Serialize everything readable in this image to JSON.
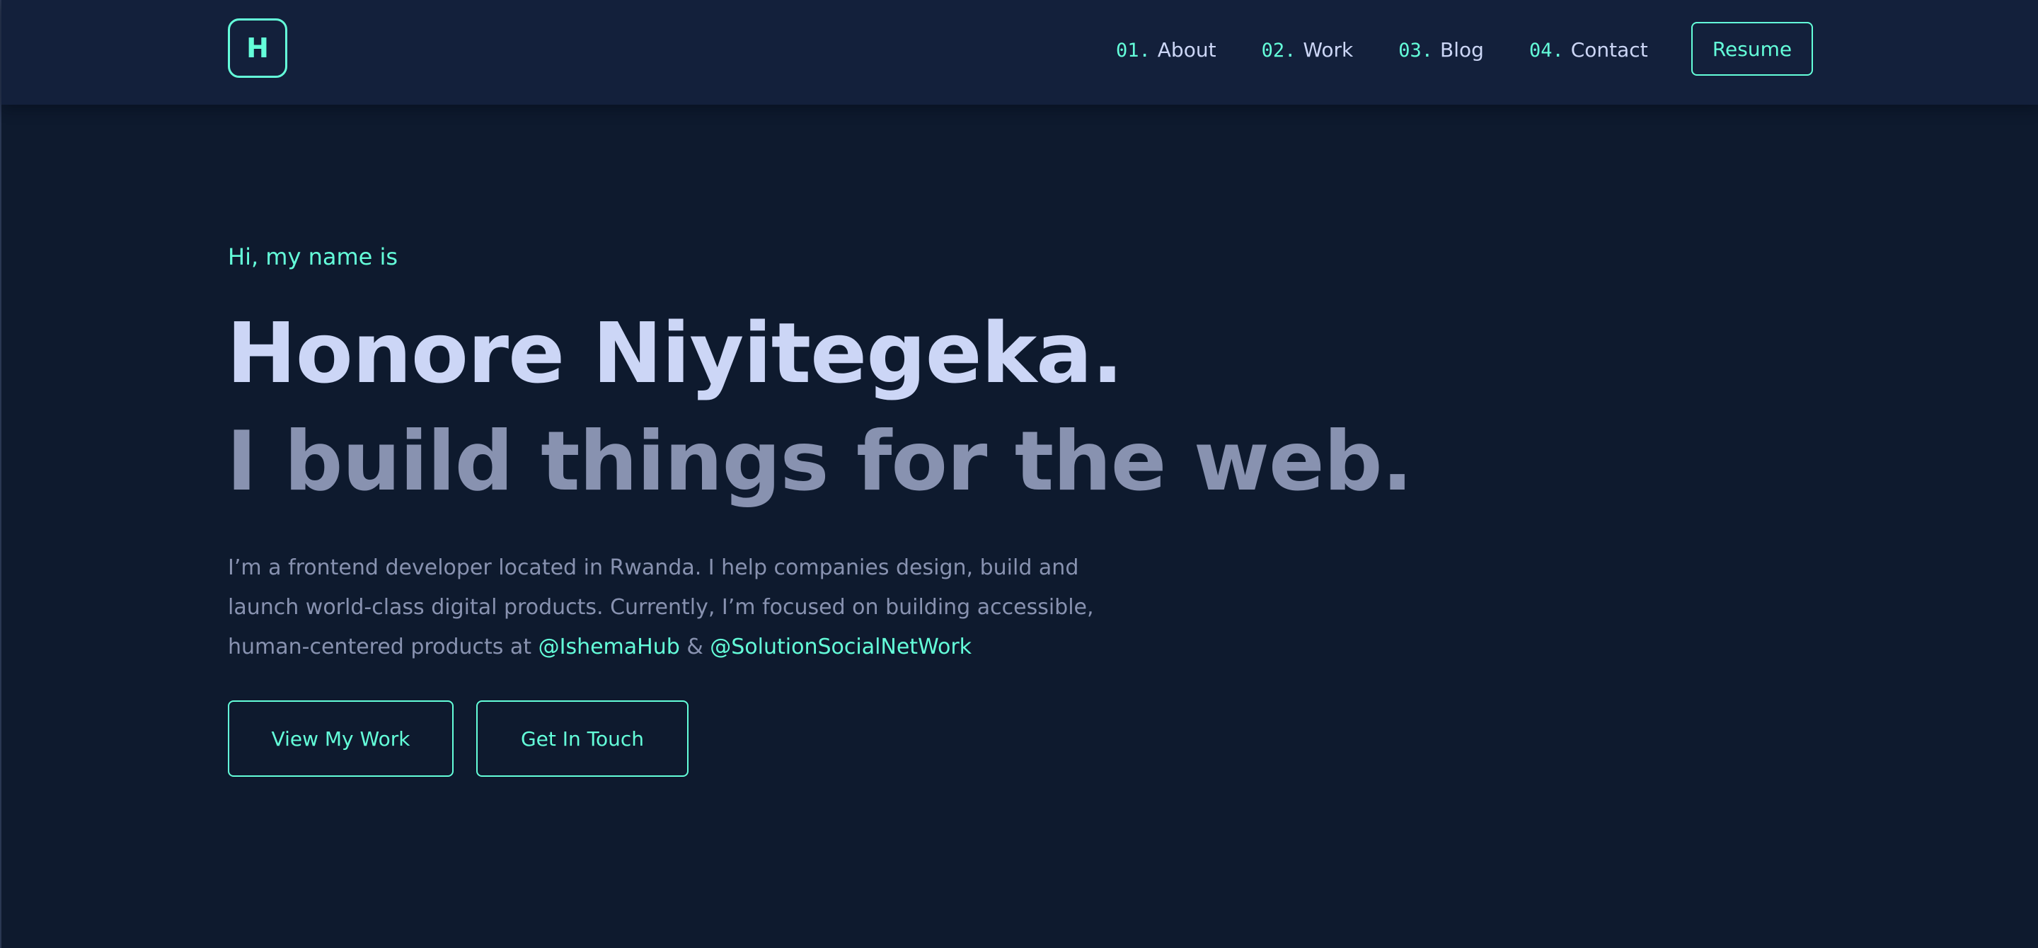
{
  "header": {
    "logo_letter": "H",
    "nav": [
      {
        "num": "01.",
        "label": "About"
      },
      {
        "num": "02.",
        "label": "Work"
      },
      {
        "num": "03.",
        "label": "Blog"
      },
      {
        "num": "04.",
        "label": "Contact"
      }
    ],
    "resume_label": "Resume"
  },
  "hero": {
    "intro": "Hi, my name is",
    "name": "Honore Niyitegeka.",
    "tagline": "I build things for the web.",
    "description": {
      "line1": "I’m a frontend developer located in Rwanda. I help companies design, build and",
      "line2": "launch world-class digital products. Currently, I’m focused on building accessible,",
      "line3_prefix": "human-centered products at ",
      "link1": "@IshemaHub",
      "separator": " & ",
      "link2": "@SolutionSocialNetWork"
    },
    "buttons": {
      "view_work": "View My Work",
      "get_in_touch": "Get In Touch"
    }
  },
  "colors": {
    "background": "#0e1a2e",
    "navbar": "#13203b",
    "accent": "#64ffda",
    "heading": "#ccd6f6",
    "muted": "#8892b0"
  }
}
